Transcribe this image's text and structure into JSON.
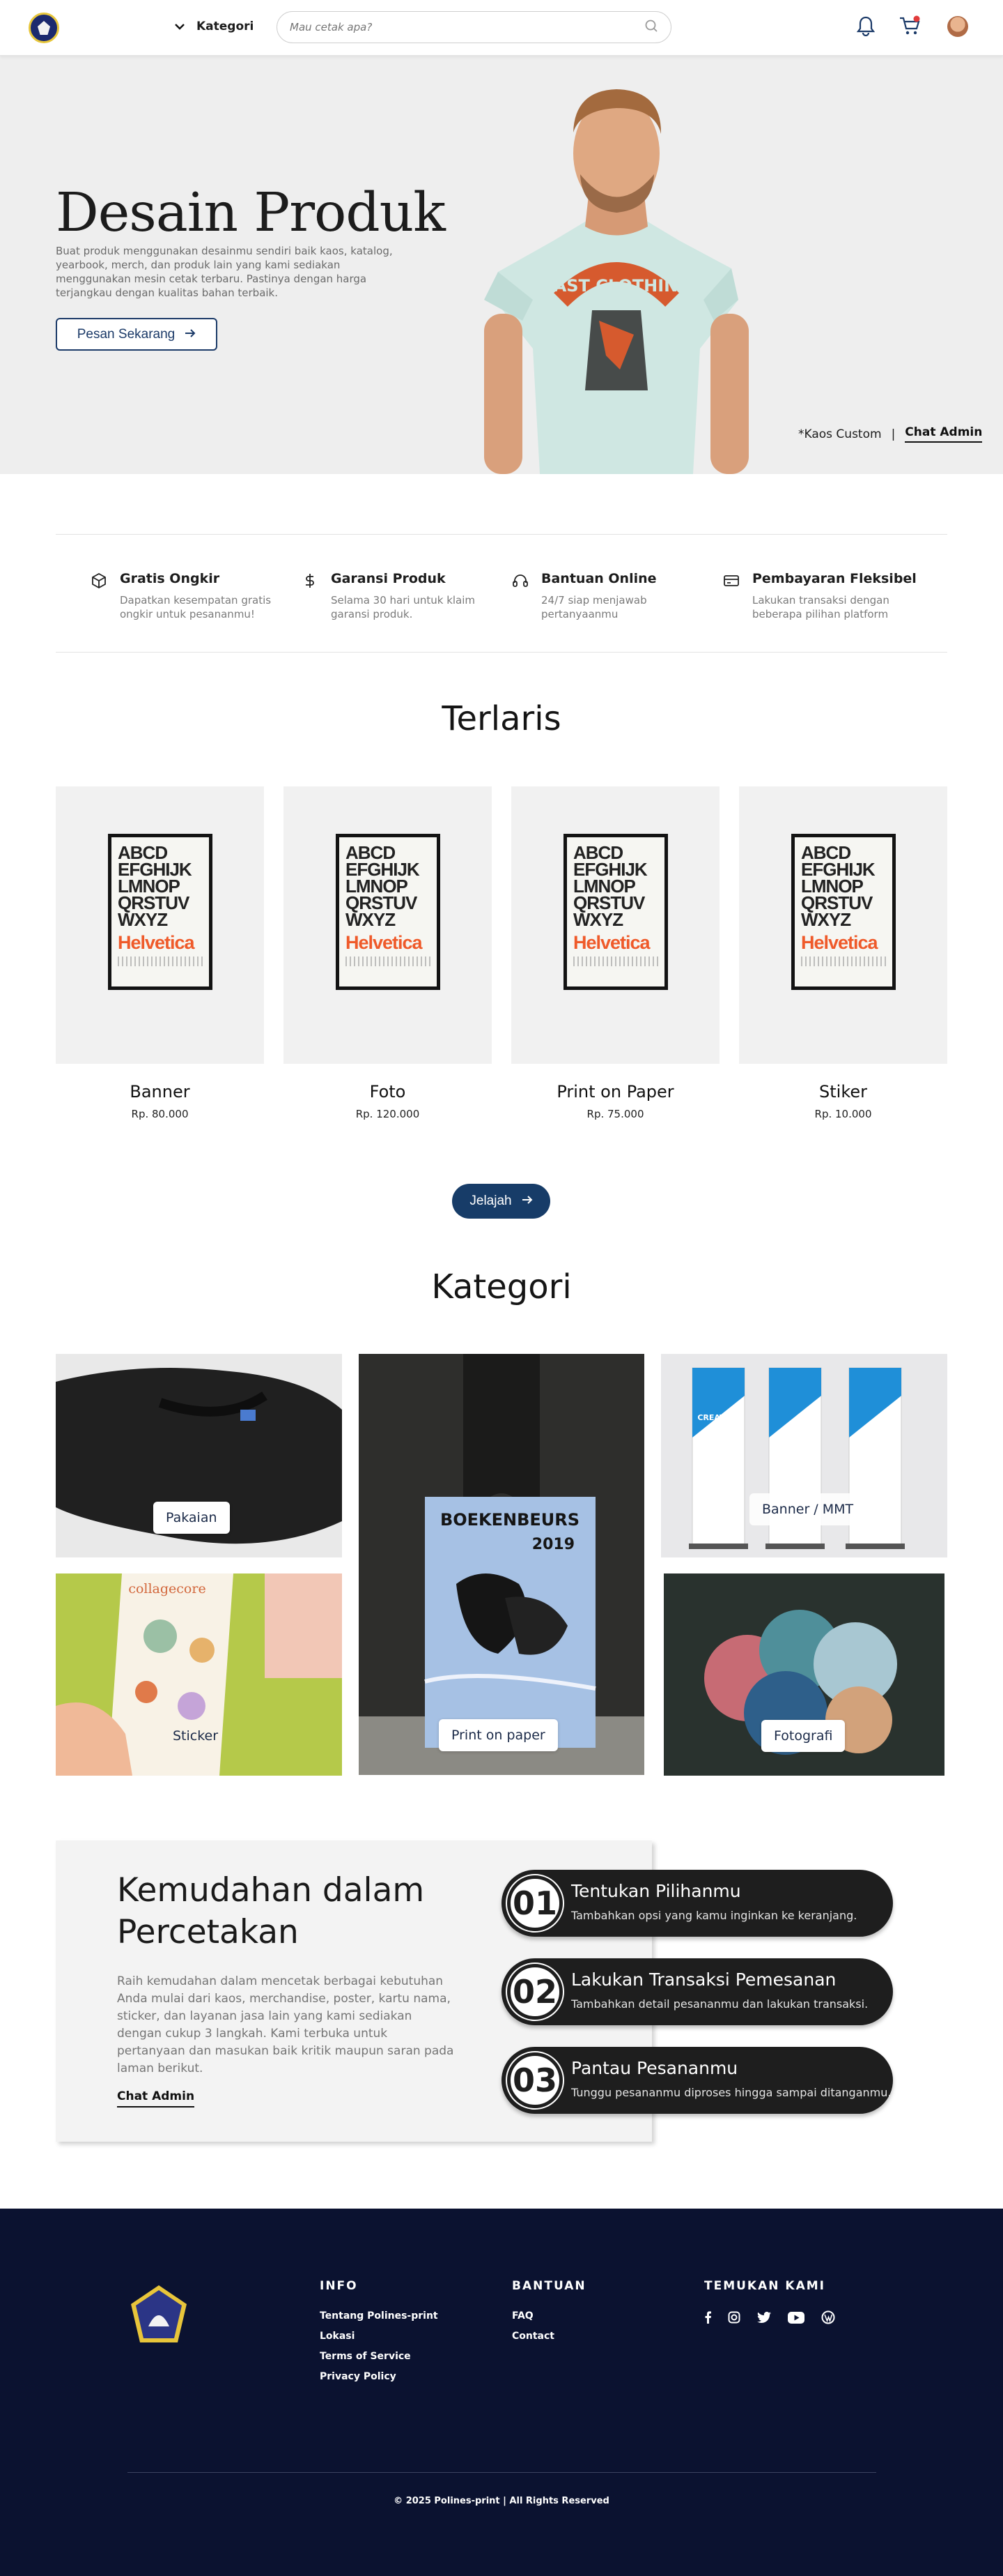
{
  "nav": {
    "category_label": "Kategori",
    "search_placeholder": "Mau cetak apa?"
  },
  "hero": {
    "title": "Desain Produk",
    "description": "Buat produk menggunakan desainmu sendiri baik kaos, katalog, yearbook, merch, dan produk lain yang kami sediakan menggunakan mesin cetak terbaru. Pastinya dengan harga terjangkau dengan kualitas bahan terbaik.",
    "cta_label": "Pesan Sekarang",
    "caption": "*Kaos Custom",
    "divider": "|",
    "chat_label": "Chat Admin",
    "shirt_text": "CAST CLOTHING"
  },
  "features": [
    {
      "icon": "box-icon",
      "title": "Gratis Ongkir",
      "desc": "Dapatkan kesempatan gratis ongkir untuk pesananmu!"
    },
    {
      "icon": "dollar-icon",
      "title": "Garansi Produk",
      "desc": "Selama 30 hari untuk klaim garansi produk."
    },
    {
      "icon": "headset-icon",
      "title": "Bantuan Online",
      "desc": "24/7 siap menjawab pertanyaanmu"
    },
    {
      "icon": "card-icon",
      "title": "Pembayaran Fleksibel",
      "desc": "Lakukan transaksi dengan beberapa pilihan platform"
    }
  ],
  "bestseller": {
    "title": "Terlaris",
    "poster_letters": "ABCD EFGHIJK LMNOP QRSTUV WXYZ",
    "poster_brand": "Helvetica",
    "products": [
      {
        "name": "Banner",
        "price": "Rp. 80.000"
      },
      {
        "name": "Foto",
        "price": "Rp. 120.000"
      },
      {
        "name": "Print on Paper",
        "price": "Rp. 75.000"
      },
      {
        "name": "Stiker",
        "price": "Rp. 10.000"
      }
    ],
    "explore_label": "Jelajah"
  },
  "categories": {
    "title": "Kategori",
    "items": [
      "Pakaian",
      "Print on paper",
      "Banner / MMT",
      "Sticker",
      "Fotografi"
    ],
    "poster_title": "BOEKENBEURS",
    "poster_year": "2019",
    "sticker_brand": "collagecore",
    "banner_word": "CREATIVE"
  },
  "ease": {
    "title": "Kemudahan dalam Percetakan",
    "description": "Raih kemudahan dalam mencetak berbagai kebutuhan Anda mulai dari kaos, merchandise, poster, kartu nama, sticker, dan layanan jasa lain yang kami sediakan dengan cukup 3 langkah. Kami terbuka untuk pertanyaan dan masukan baik kritik maupun saran pada laman berikut.",
    "link": "Chat Admin",
    "steps": [
      {
        "num": "01",
        "title": "Tentukan Pilihanmu",
        "desc": "Tambahkan opsi yang kamu inginkan ke keranjang."
      },
      {
        "num": "02",
        "title": "Lakukan Transaksi Pemesanan",
        "desc": "Tambahkan detail pesananmu dan lakukan transaksi."
      },
      {
        "num": "03",
        "title": "Pantau Pesananmu",
        "desc": "Tunggu pesananmu diproses hingga sampai ditanganmu."
      }
    ]
  },
  "footer": {
    "info_title": "INFO",
    "info_links": [
      "Tentang Polines-print",
      "Lokasi",
      "Terms of Service",
      "Privacy Policy"
    ],
    "help_title": "BANTUAN",
    "help_links": [
      "FAQ",
      "Contact"
    ],
    "social_title": "TEMUKAN KAMI",
    "social_icons": [
      "facebook-icon",
      "instagram-icon",
      "twitter-icon",
      "youtube-icon",
      "wordpress-icon"
    ],
    "copyright": "© 2025 Polines-print | All Rights Reserved"
  },
  "colors": {
    "primary": "#173c68",
    "footer_bg": "#0b1230",
    "hero_bg": "#eeeeee",
    "accent_orange": "#ef5a2a"
  }
}
